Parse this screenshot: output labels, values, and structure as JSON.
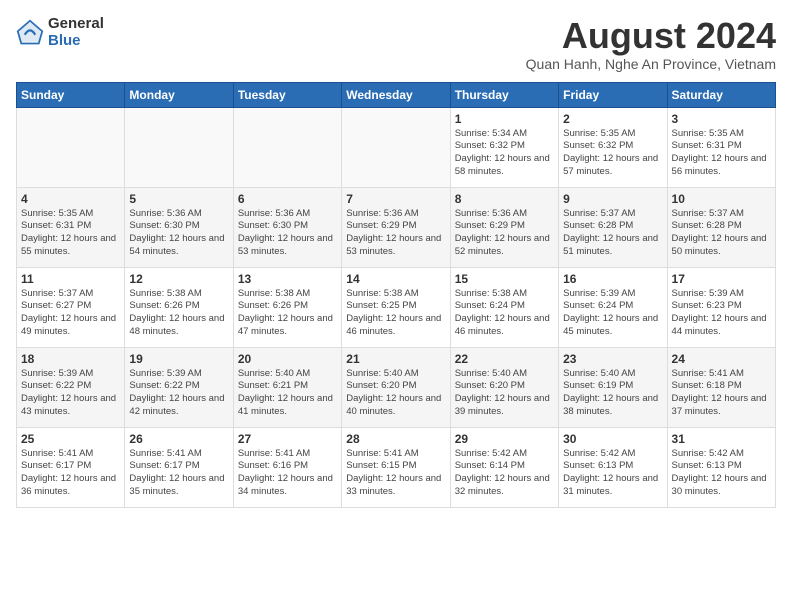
{
  "logo": {
    "general": "General",
    "blue": "Blue"
  },
  "title": {
    "month_year": "August 2024",
    "location": "Quan Hanh, Nghe An Province, Vietnam"
  },
  "headers": [
    "Sunday",
    "Monday",
    "Tuesday",
    "Wednesday",
    "Thursday",
    "Friday",
    "Saturday"
  ],
  "weeks": [
    [
      {
        "day": "",
        "content": ""
      },
      {
        "day": "",
        "content": ""
      },
      {
        "day": "",
        "content": ""
      },
      {
        "day": "",
        "content": ""
      },
      {
        "day": "1",
        "content": "Sunrise: 5:34 AM\nSunset: 6:32 PM\nDaylight: 12 hours\nand 58 minutes."
      },
      {
        "day": "2",
        "content": "Sunrise: 5:35 AM\nSunset: 6:32 PM\nDaylight: 12 hours\nand 57 minutes."
      },
      {
        "day": "3",
        "content": "Sunrise: 5:35 AM\nSunset: 6:31 PM\nDaylight: 12 hours\nand 56 minutes."
      }
    ],
    [
      {
        "day": "4",
        "content": "Sunrise: 5:35 AM\nSunset: 6:31 PM\nDaylight: 12 hours\nand 55 minutes."
      },
      {
        "day": "5",
        "content": "Sunrise: 5:36 AM\nSunset: 6:30 PM\nDaylight: 12 hours\nand 54 minutes."
      },
      {
        "day": "6",
        "content": "Sunrise: 5:36 AM\nSunset: 6:30 PM\nDaylight: 12 hours\nand 53 minutes."
      },
      {
        "day": "7",
        "content": "Sunrise: 5:36 AM\nSunset: 6:29 PM\nDaylight: 12 hours\nand 53 minutes."
      },
      {
        "day": "8",
        "content": "Sunrise: 5:36 AM\nSunset: 6:29 PM\nDaylight: 12 hours\nand 52 minutes."
      },
      {
        "day": "9",
        "content": "Sunrise: 5:37 AM\nSunset: 6:28 PM\nDaylight: 12 hours\nand 51 minutes."
      },
      {
        "day": "10",
        "content": "Sunrise: 5:37 AM\nSunset: 6:28 PM\nDaylight: 12 hours\nand 50 minutes."
      }
    ],
    [
      {
        "day": "11",
        "content": "Sunrise: 5:37 AM\nSunset: 6:27 PM\nDaylight: 12 hours\nand 49 minutes."
      },
      {
        "day": "12",
        "content": "Sunrise: 5:38 AM\nSunset: 6:26 PM\nDaylight: 12 hours\nand 48 minutes."
      },
      {
        "day": "13",
        "content": "Sunrise: 5:38 AM\nSunset: 6:26 PM\nDaylight: 12 hours\nand 47 minutes."
      },
      {
        "day": "14",
        "content": "Sunrise: 5:38 AM\nSunset: 6:25 PM\nDaylight: 12 hours\nand 46 minutes."
      },
      {
        "day": "15",
        "content": "Sunrise: 5:38 AM\nSunset: 6:24 PM\nDaylight: 12 hours\nand 46 minutes."
      },
      {
        "day": "16",
        "content": "Sunrise: 5:39 AM\nSunset: 6:24 PM\nDaylight: 12 hours\nand 45 minutes."
      },
      {
        "day": "17",
        "content": "Sunrise: 5:39 AM\nSunset: 6:23 PM\nDaylight: 12 hours\nand 44 minutes."
      }
    ],
    [
      {
        "day": "18",
        "content": "Sunrise: 5:39 AM\nSunset: 6:22 PM\nDaylight: 12 hours\nand 43 minutes."
      },
      {
        "day": "19",
        "content": "Sunrise: 5:39 AM\nSunset: 6:22 PM\nDaylight: 12 hours\nand 42 minutes."
      },
      {
        "day": "20",
        "content": "Sunrise: 5:40 AM\nSunset: 6:21 PM\nDaylight: 12 hours\nand 41 minutes."
      },
      {
        "day": "21",
        "content": "Sunrise: 5:40 AM\nSunset: 6:20 PM\nDaylight: 12 hours\nand 40 minutes."
      },
      {
        "day": "22",
        "content": "Sunrise: 5:40 AM\nSunset: 6:20 PM\nDaylight: 12 hours\nand 39 minutes."
      },
      {
        "day": "23",
        "content": "Sunrise: 5:40 AM\nSunset: 6:19 PM\nDaylight: 12 hours\nand 38 minutes."
      },
      {
        "day": "24",
        "content": "Sunrise: 5:41 AM\nSunset: 6:18 PM\nDaylight: 12 hours\nand 37 minutes."
      }
    ],
    [
      {
        "day": "25",
        "content": "Sunrise: 5:41 AM\nSunset: 6:17 PM\nDaylight: 12 hours\nand 36 minutes."
      },
      {
        "day": "26",
        "content": "Sunrise: 5:41 AM\nSunset: 6:17 PM\nDaylight: 12 hours\nand 35 minutes."
      },
      {
        "day": "27",
        "content": "Sunrise: 5:41 AM\nSunset: 6:16 PM\nDaylight: 12 hours\nand 34 minutes."
      },
      {
        "day": "28",
        "content": "Sunrise: 5:41 AM\nSunset: 6:15 PM\nDaylight: 12 hours\nand 33 minutes."
      },
      {
        "day": "29",
        "content": "Sunrise: 5:42 AM\nSunset: 6:14 PM\nDaylight: 12 hours\nand 32 minutes."
      },
      {
        "day": "30",
        "content": "Sunrise: 5:42 AM\nSunset: 6:13 PM\nDaylight: 12 hours\nand 31 minutes."
      },
      {
        "day": "31",
        "content": "Sunrise: 5:42 AM\nSunset: 6:13 PM\nDaylight: 12 hours\nand 30 minutes."
      }
    ]
  ]
}
